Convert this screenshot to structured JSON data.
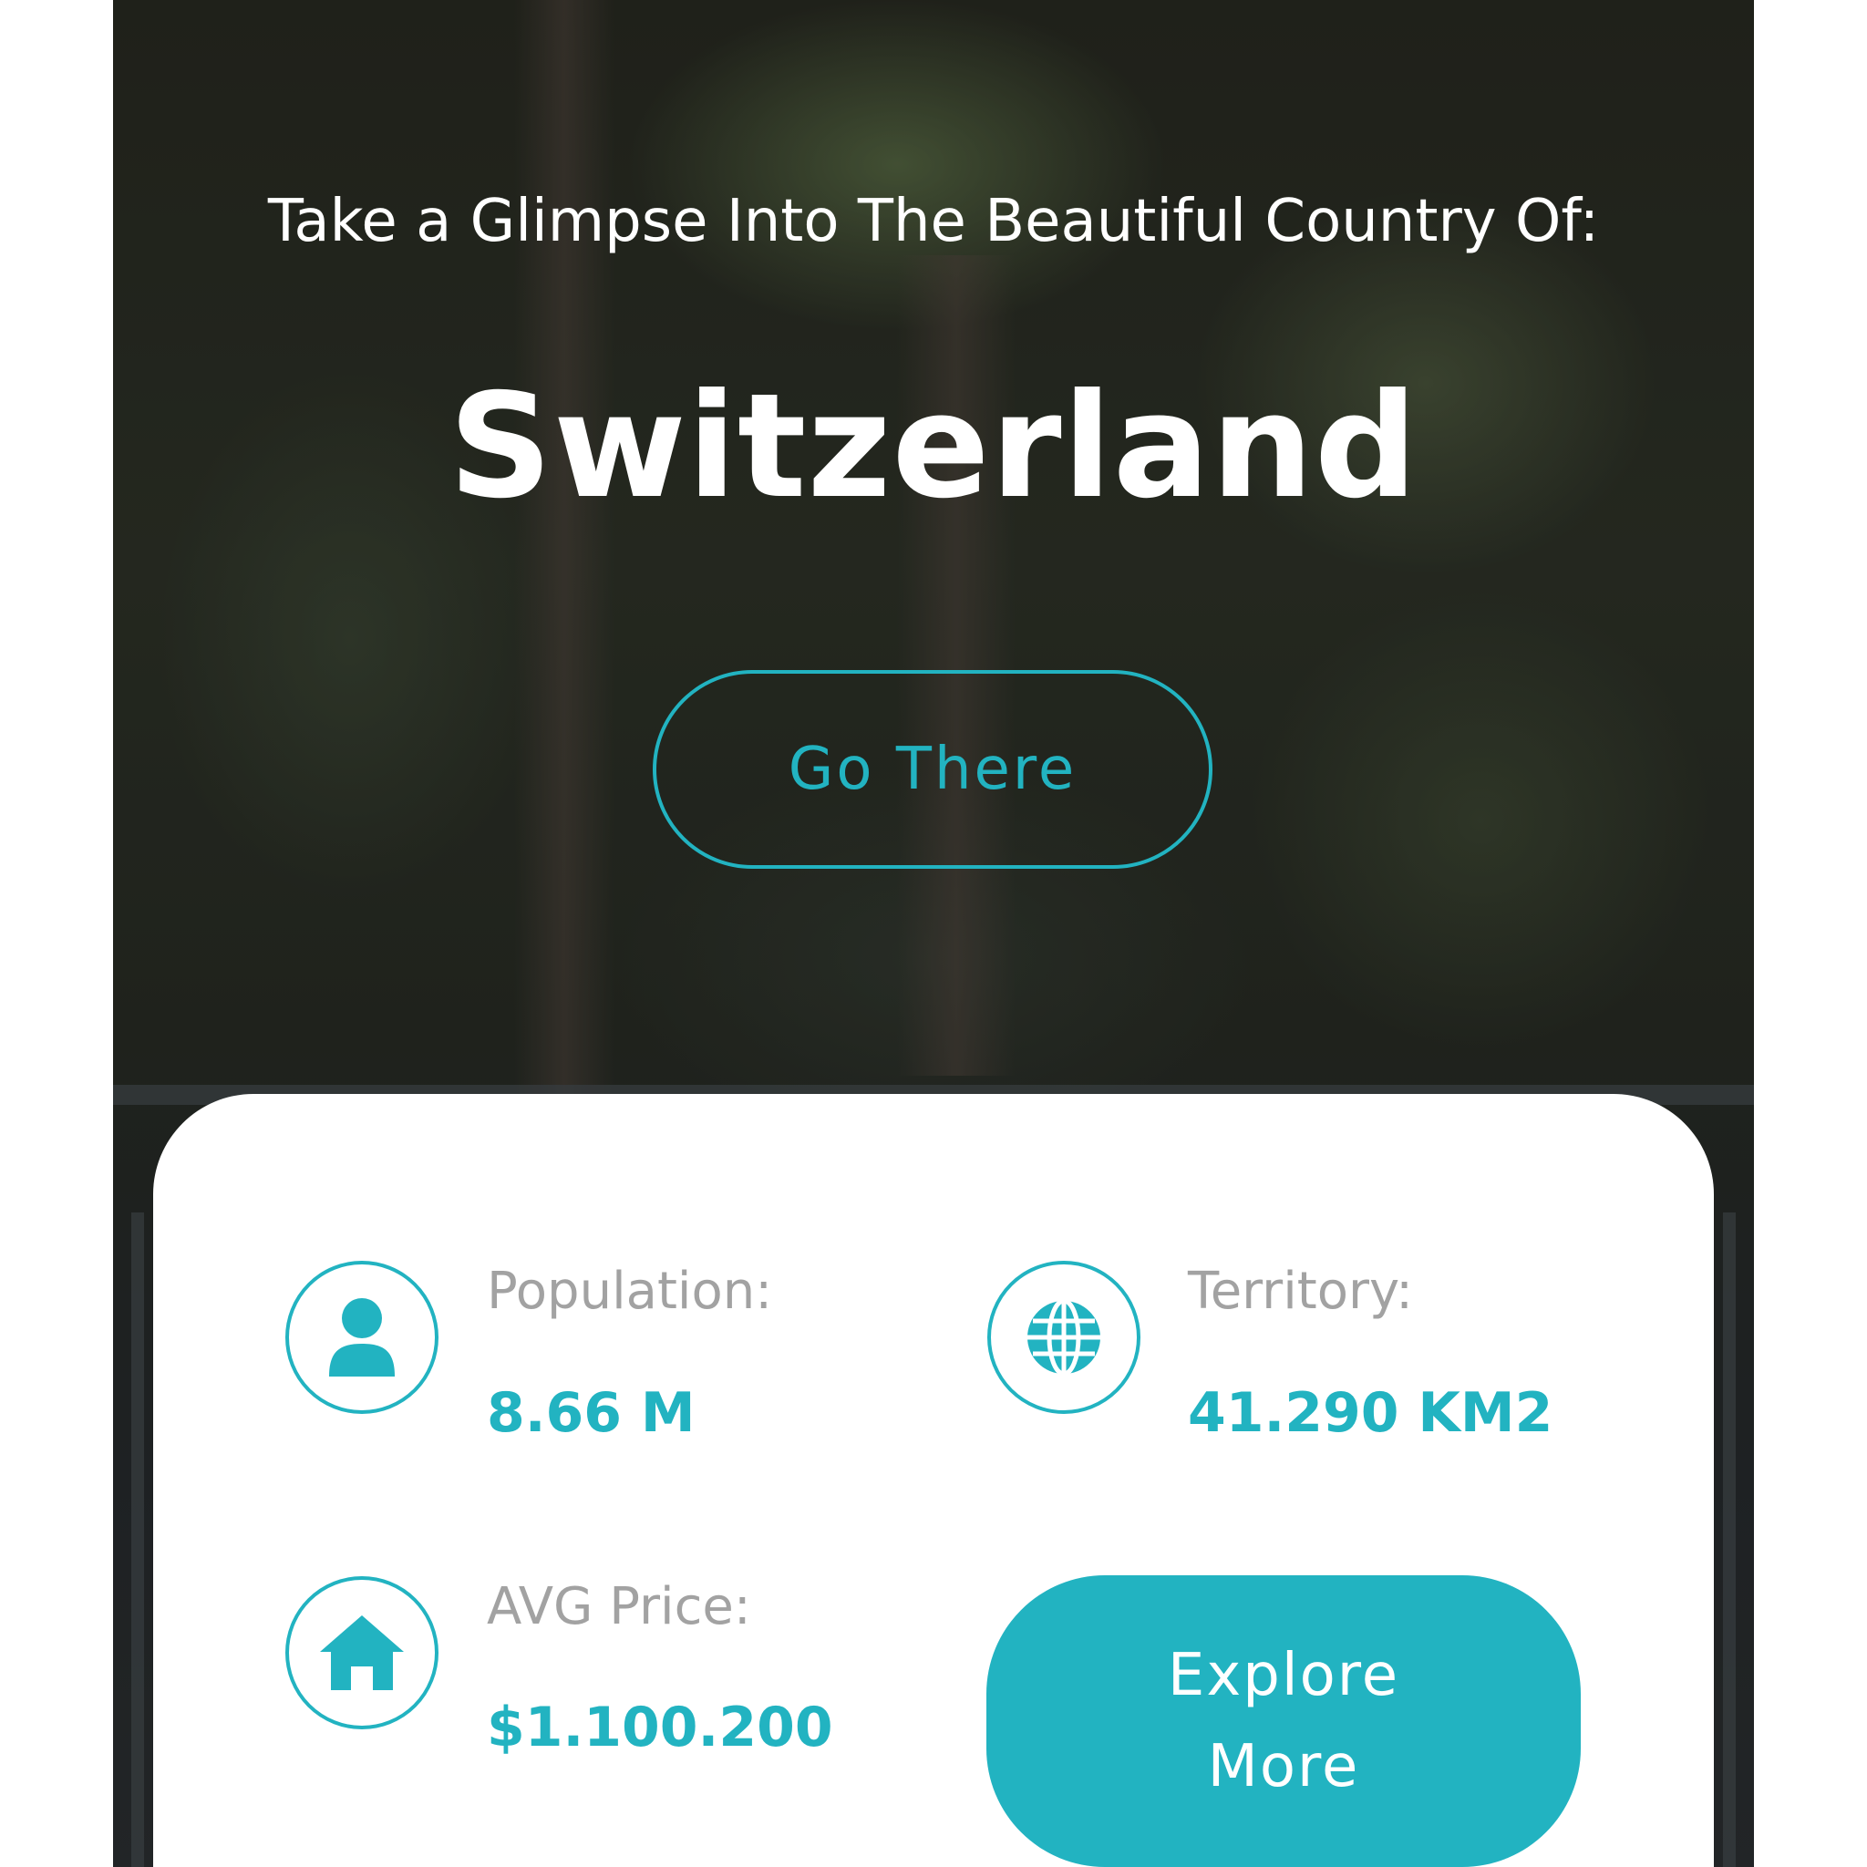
{
  "hero": {
    "subtitle": "Take a Glimpse Into The Beautiful Country Of:",
    "country": "Switzerland",
    "go_button": "Go There"
  },
  "stats": {
    "population": {
      "label": "Population:",
      "value": "8.66 M",
      "icon": "person-icon"
    },
    "territory": {
      "label": "Territory:",
      "value": "41.290 KM2",
      "icon": "globe-icon"
    },
    "avg_price": {
      "label": "AVG Price:",
      "value": "$1.100.200",
      "icon": "home-icon"
    }
  },
  "explore_button": {
    "line1": "Explore",
    "line2": "More"
  },
  "colors": {
    "accent": "#22b3c1",
    "label_gray": "#a2a2a2",
    "text_on_dark": "#ffffff"
  }
}
